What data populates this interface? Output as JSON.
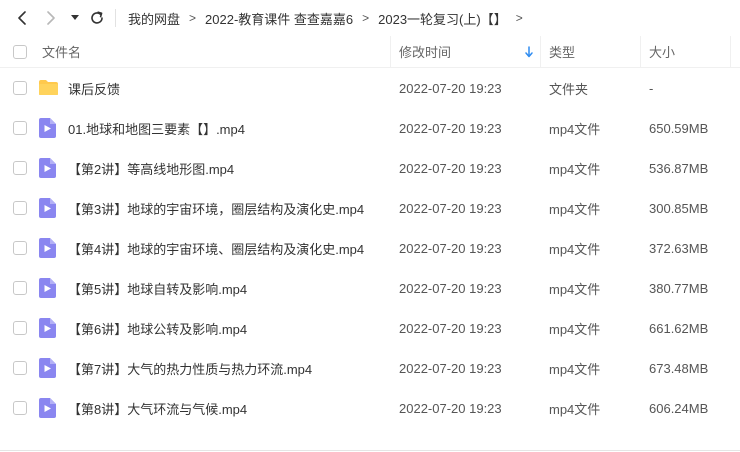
{
  "breadcrumb": {
    "items": [
      "我的网盘",
      "2022-教育课件 查查嘉嘉6",
      "2023一轮复习(上)【】"
    ],
    "separator": ">"
  },
  "table": {
    "headers": {
      "name": "文件名",
      "modified": "修改时间",
      "type": "类型",
      "size": "大小"
    },
    "sort": {
      "column": "modified",
      "direction": "descending",
      "icon": "arrow-down-icon"
    },
    "rows": [
      {
        "name": "课后反馈",
        "modified": "2022-07-20 19:23",
        "type": "文件夹",
        "size": "-",
        "icon": "folder-icon"
      },
      {
        "name": "01.地球和地图三要素【】.mp4",
        "modified": "2022-07-20 19:23",
        "type": "mp4文件",
        "size": "650.59MB",
        "icon": "video-file-icon"
      },
      {
        "name": "【第2讲】等高线地形图.mp4",
        "modified": "2022-07-20 19:23",
        "type": "mp4文件",
        "size": "536.87MB",
        "icon": "video-file-icon"
      },
      {
        "name": "【第3讲】地球的宇宙环境，圈层结构及演化史.mp4",
        "modified": "2022-07-20 19:23",
        "type": "mp4文件",
        "size": "300.85MB",
        "icon": "video-file-icon"
      },
      {
        "name": "【第4讲】地球的宇宙环境、圈层结构及演化史.mp4",
        "modified": "2022-07-20 19:23",
        "type": "mp4文件",
        "size": "372.63MB",
        "icon": "video-file-icon"
      },
      {
        "name": "【第5讲】地球自转及影响.mp4",
        "modified": "2022-07-20 19:23",
        "type": "mp4文件",
        "size": "380.77MB",
        "icon": "video-file-icon"
      },
      {
        "name": "【第6讲】地球公转及影响.mp4",
        "modified": "2022-07-20 19:23",
        "type": "mp4文件",
        "size": "661.62MB",
        "icon": "video-file-icon"
      },
      {
        "name": "【第7讲】大气的热力性质与热力环流.mp4",
        "modified": "2022-07-20 19:23",
        "type": "mp4文件",
        "size": "673.48MB",
        "icon": "video-file-icon"
      },
      {
        "name": "【第8讲】大气环流与气候.mp4",
        "modified": "2022-07-20 19:23",
        "type": "mp4文件",
        "size": "606.24MB",
        "icon": "video-file-icon"
      }
    ]
  },
  "colors": {
    "folder": "#FFC94D",
    "video": "#8A86F0",
    "sort_arrow": "#2F8CF0"
  }
}
